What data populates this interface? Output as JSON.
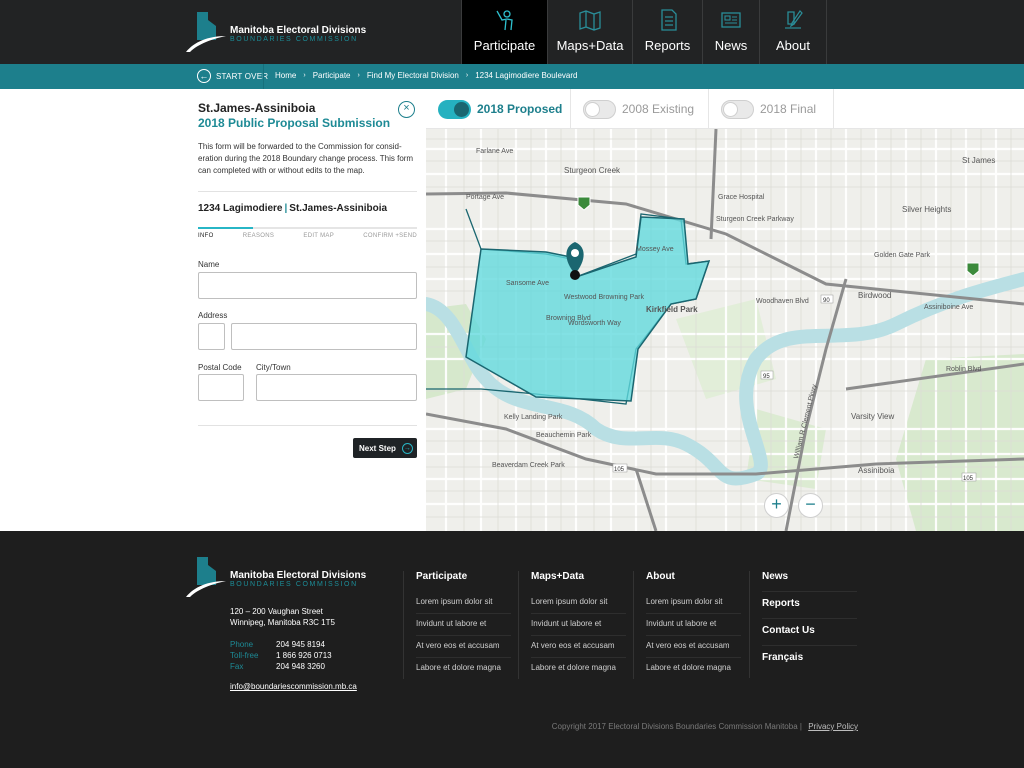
{
  "brand": {
    "title": "Manitoba Electoral Divisions",
    "subtitle": "BOUNDARIES COMMISSION"
  },
  "nav": [
    {
      "label": "Participate",
      "icon": "person-raising-hand-icon",
      "active": true
    },
    {
      "label": "Maps+Data",
      "icon": "folded-map-icon",
      "active": false
    },
    {
      "label": "Reports",
      "icon": "document-icon",
      "active": false
    },
    {
      "label": "News",
      "icon": "newspaper-icon",
      "active": false
    },
    {
      "label": "About",
      "icon": "pen-writing-icon",
      "active": false
    }
  ],
  "breadcrumb": {
    "start_over": "START OVER",
    "items": [
      "Home",
      "Participate",
      "Find My Electoral Division",
      "1234 Lagimodiere Boulevard"
    ]
  },
  "panel": {
    "title": "St.James-Assiniboia",
    "subtitle": "2018 Public Proposal Submission",
    "description": "This form will be forwarded to the Commission for consid-eration during the 2018 Boundary change process. This form can completed with or without edits to the map.",
    "address_street": "1234 Lagimodiere",
    "address_division": "St.James-Assiniboia",
    "steps": [
      "INFO",
      "REASONS",
      "EDIT MAP",
      "CONFIRM +SEND"
    ],
    "progress": 0.25,
    "fields": {
      "name_label": "Name",
      "address_label": "Address",
      "postal_label": "Postal Code",
      "city_label": "City/Town"
    },
    "next_label": "Next Step"
  },
  "map_toggles": [
    {
      "label": "2018 Proposed",
      "on": true
    },
    {
      "label": "2008 Existing",
      "on": false
    },
    {
      "label": "2018 Final",
      "on": false
    }
  ],
  "map_labels": {
    "streets": [
      "Sturgeon Creek",
      "Portage Ave",
      "Farlane Ave",
      "Silver Heights",
      "St James",
      "Birdwood",
      "Woodhaven Blvd",
      "Roblin Blvd",
      "Varsity View",
      "Assiniboine Ave",
      "Assiniboia",
      "Kirkfield Park",
      "Westwood Browning Park",
      "Browning Blvd",
      "Wordsworth Way",
      "Kelly Landing Park",
      "Beauchemin Park",
      "Beaverdam Creek Park",
      "Golden Gate Park",
      "Sturgeon Creek Parkway",
      "Grace Hospital",
      "Mossey Ave",
      "William R Clement Pkwy",
      "Sansome Ave"
    ],
    "route_numbers": [
      "90",
      "95",
      "105",
      "105"
    ]
  },
  "zoom": {
    "in": "+",
    "out": "−"
  },
  "footer": {
    "address_line1": "120 – 200 Vaughan Street",
    "address_line2": "Winnipeg, Manitoba R3C 1T5",
    "contacts": [
      {
        "k": "Phone",
        "v": "204 945 8194"
      },
      {
        "k": "Toll-free",
        "v": "1 866 926 0713"
      },
      {
        "k": "Fax",
        "v": "204 948 3260"
      }
    ],
    "email": "info@boundariescommission.mb.ca",
    "columns": [
      {
        "title": "Participate",
        "links": [
          "Lorem ipsum dolor sit",
          "Invidunt ut labore et",
          "At vero eos et accusam",
          "Labore et dolore magna"
        ]
      },
      {
        "title": "Maps+Data",
        "links": [
          "Lorem ipsum dolor sit",
          "Invidunt ut labore et",
          "At vero eos et accusam",
          "Labore et dolore magna"
        ]
      },
      {
        "title": "About",
        "links": [
          "Lorem ipsum dolor sit",
          "Invidunt ut labore et",
          "At vero eos et accusam",
          "Labore et dolore magna"
        ]
      }
    ],
    "extra_links": [
      "News",
      "Reports",
      "Contact Us",
      "Français"
    ],
    "copyright": "Copyright 2017 Electoral Divisions Boundaries Commission Manitoba",
    "privacy": "Privacy Policy"
  },
  "colors": {
    "accent": "#1d7f8c",
    "toggle_on": "#25b1c0",
    "boundary_fill": "#5fd8dc",
    "river": "#b9dfe4"
  }
}
